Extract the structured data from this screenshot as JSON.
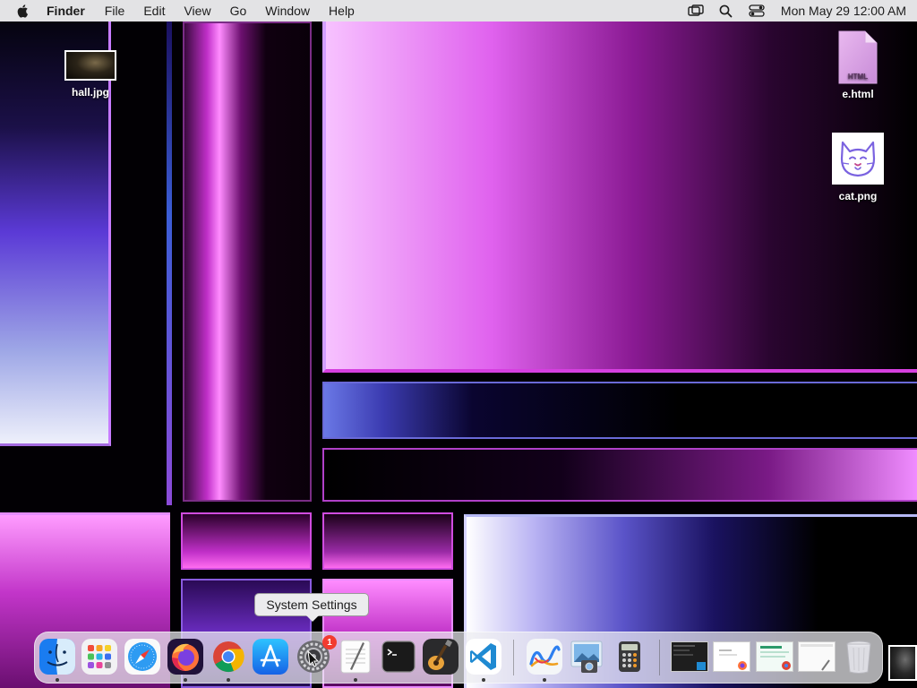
{
  "menubar": {
    "app_name": "Finder",
    "menus": [
      "File",
      "Edit",
      "View",
      "Go",
      "Window",
      "Help"
    ],
    "status_icons": [
      "screen-mirroring-icon",
      "search-icon",
      "control-center-icon"
    ],
    "clock": "Mon May 29  12:00 AM"
  },
  "desktop": {
    "icons": [
      {
        "name": "hall.jpg"
      },
      {
        "name": "e.html",
        "badge_text": "HTML"
      },
      {
        "name": "cat.png"
      }
    ]
  },
  "tooltip": "System Settings",
  "dock": {
    "apps": [
      "Finder",
      "Launchpad",
      "Safari",
      "Firefox",
      "Google Chrome",
      "App Store",
      "System Settings",
      "TextEdit",
      "Terminal",
      "GarageBand",
      "Visual Studio Code",
      "Freeform",
      "Preview",
      "Calculator"
    ],
    "settings_badge": "1",
    "minimized_windows": [
      "Visual Studio Code window",
      "Firefox window",
      "Google Chrome window",
      "TextEdit window"
    ],
    "trash": "Trash"
  },
  "colors": {
    "menubar_bg": "#ececee",
    "badge": "#f23b30",
    "vscode": "#1f8ad2",
    "terminal": "#1a1a1a"
  }
}
